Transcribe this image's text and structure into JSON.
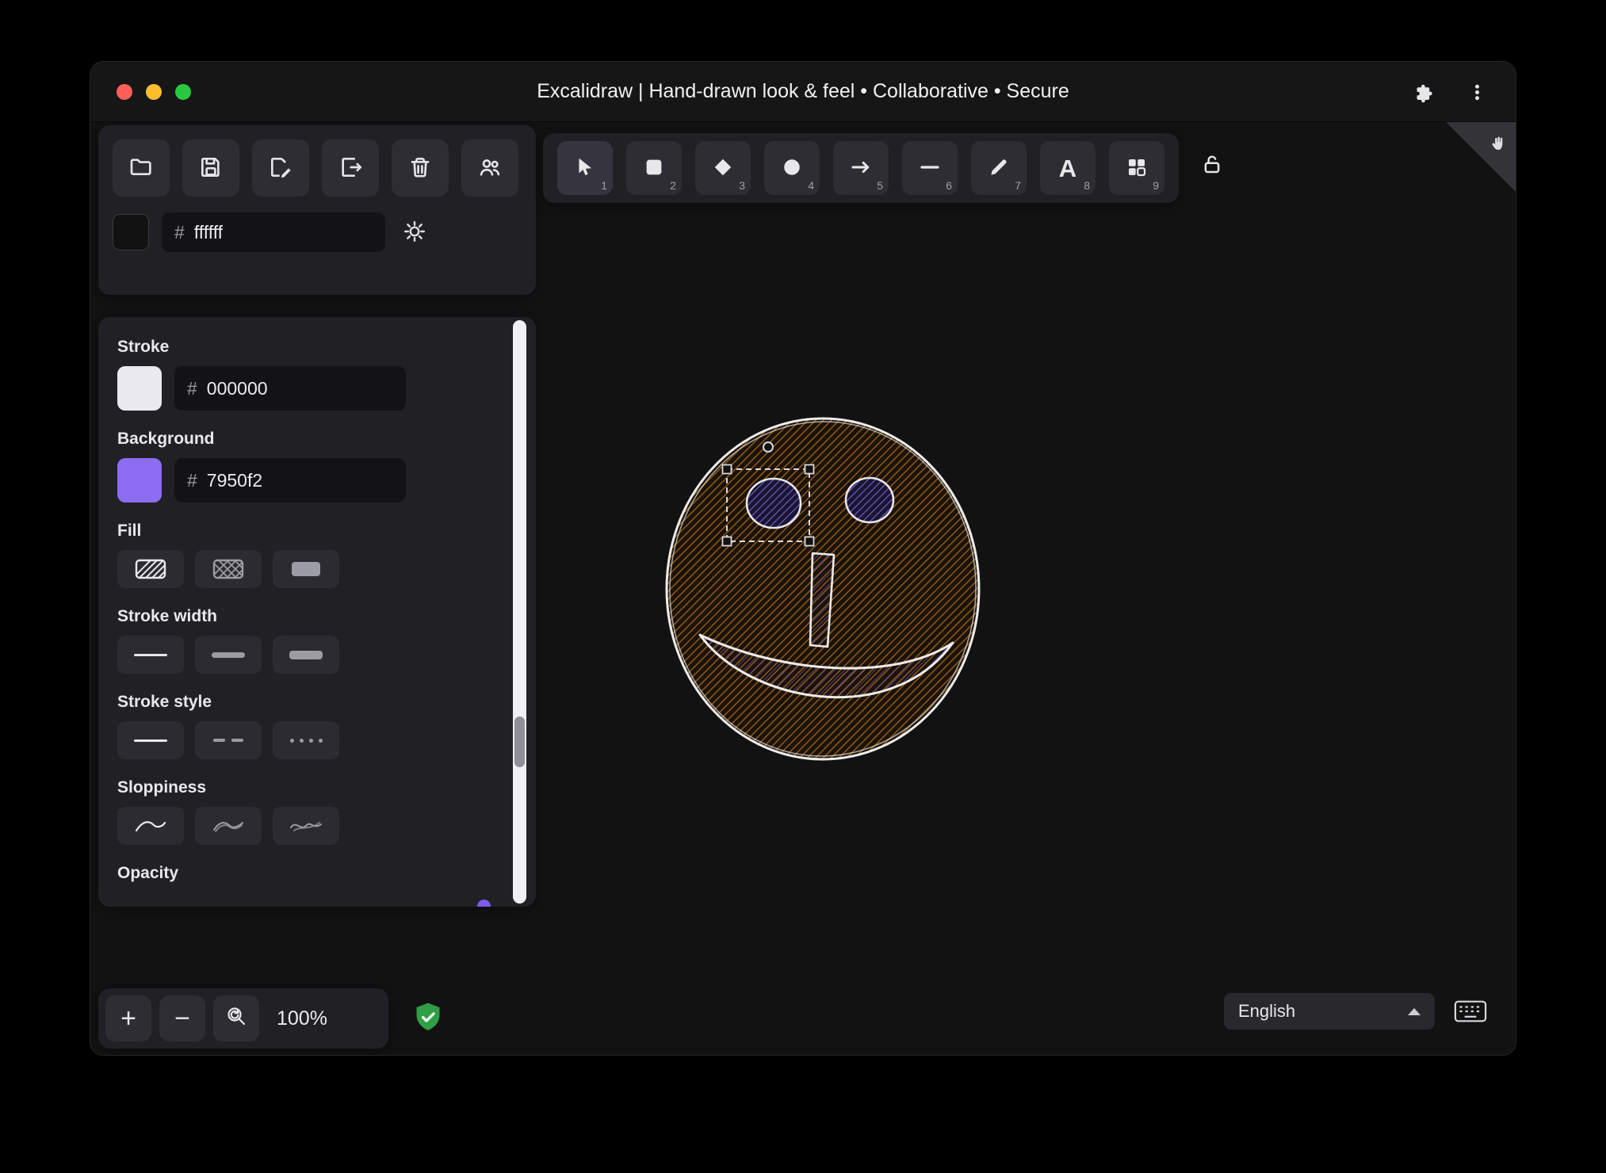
{
  "window": {
    "title": "Excalidraw | Hand-drawn look & feel • Collaborative • Secure"
  },
  "icons": {
    "titlebar_right": [
      "extensions-puzzle-icon",
      "overflow-menu-icon"
    ],
    "file_toolbar": [
      "open-folder-icon",
      "save-icon",
      "save-as-icon",
      "export-file-icon",
      "trash-icon",
      "collaborators-icon"
    ],
    "theme_toggle": "sun-icon",
    "tool_lock": "unlock-icon",
    "canvas_corner": "hand-icon",
    "zoom_reset": "magnifier-reset-icon",
    "encryption": "shield-check-icon",
    "keyboard": "keyboard-icon"
  },
  "canvas_background": {
    "hash": "#",
    "value": "ffffff"
  },
  "tools": [
    {
      "shortcut": "1",
      "name": "selection"
    },
    {
      "shortcut": "2",
      "name": "rectangle"
    },
    {
      "shortcut": "3",
      "name": "diamond"
    },
    {
      "shortcut": "4",
      "name": "ellipse"
    },
    {
      "shortcut": "5",
      "name": "arrow"
    },
    {
      "shortcut": "6",
      "name": "line"
    },
    {
      "shortcut": "7",
      "name": "draw"
    },
    {
      "shortcut": "8",
      "name": "text",
      "glyph": "A"
    },
    {
      "shortcut": "9",
      "name": "shapes"
    }
  ],
  "panel": {
    "stroke": {
      "label": "Stroke",
      "hash": "#",
      "value": "000000",
      "swatch_color": "#e9e9ef"
    },
    "background": {
      "label": "Background",
      "hash": "#",
      "value": "7950f2",
      "swatch_color": "#8d6cf2"
    },
    "fill": {
      "label": "Fill",
      "options": [
        "hachure",
        "cross-hatch",
        "solid"
      ]
    },
    "stroke_width": {
      "label": "Stroke width",
      "options": [
        "thin",
        "bold",
        "extra-bold"
      ]
    },
    "stroke_style": {
      "label": "Stroke style",
      "options": [
        "solid",
        "dashed",
        "dotted"
      ]
    },
    "sloppiness": {
      "label": "Sloppiness",
      "options": [
        "architect",
        "artist",
        "cartoonist"
      ]
    },
    "opacity": {
      "label": "Opacity"
    }
  },
  "footer": {
    "zoom_in": "+",
    "zoom_out": "−",
    "zoom_value": "100%",
    "language": "English"
  },
  "drawing": {
    "description": "hand-drawn smiley face, left eye selected",
    "face_hatch_color": "#96601f",
    "eye_hatch_color": "#7563d8",
    "stroke_color": "#ececec",
    "selection_style": "dashed box with corner handles and rotation handle"
  },
  "colors": {
    "canvas": "#121212",
    "island": "#202025",
    "button": "#2d2d33",
    "accent_purple": "#7950f2",
    "shield_green": "#2f9e44",
    "traffic_close": "#ff5f57",
    "traffic_min": "#febc2e",
    "traffic_max": "#28c840"
  }
}
